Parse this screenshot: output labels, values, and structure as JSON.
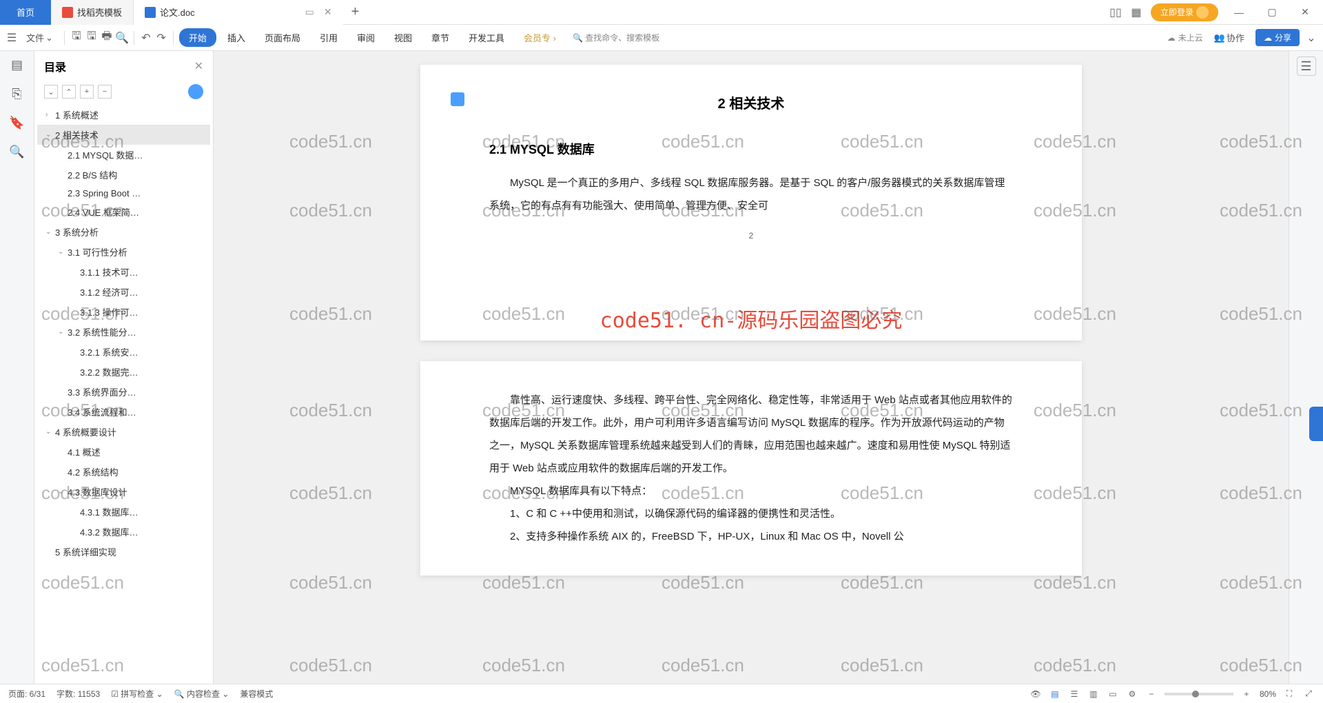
{
  "titlebar": {
    "home": "首页",
    "tab1": "找稻壳模板",
    "tab2": "论文.doc",
    "login": "立即登录"
  },
  "toolbar": {
    "file": "文件",
    "menus": [
      "开始",
      "插入",
      "页面布局",
      "引用",
      "审阅",
      "视图",
      "章节",
      "开发工具",
      "会员专"
    ],
    "search_placeholder": "查找命令、搜索模板",
    "cloud": "未上云",
    "collab": "协作",
    "share": "分享"
  },
  "outline": {
    "title": "目录",
    "items": [
      {
        "level": 1,
        "chev": "›",
        "text": "1 系统概述"
      },
      {
        "level": 1,
        "chev": "⌄",
        "text": "2 相关技术",
        "selected": true
      },
      {
        "level": 2,
        "text": "2.1 MYSQL 数据…"
      },
      {
        "level": 2,
        "text": "2.2 B/S 结构"
      },
      {
        "level": 2,
        "text": "2.3 Spring Boot …"
      },
      {
        "level": 2,
        "text": "2.4 VUE 框架简…"
      },
      {
        "level": 1,
        "chev": "⌄",
        "text": "3 系统分析"
      },
      {
        "level": 2,
        "chev": "⌄",
        "text": "3.1 可行性分析"
      },
      {
        "level": 3,
        "text": "3.1.1 技术可…"
      },
      {
        "level": 3,
        "text": "3.1.2 经济可…"
      },
      {
        "level": 3,
        "text": "3.1.3 操作可…"
      },
      {
        "level": 2,
        "chev": "⌄",
        "text": "3.2 系统性能分…"
      },
      {
        "level": 3,
        "text": "3.2.1 系统安…"
      },
      {
        "level": 3,
        "text": "3.2.2 数据完…"
      },
      {
        "level": 2,
        "text": "3.3 系统界面分…"
      },
      {
        "level": 2,
        "text": "3.4 系统流程和…"
      },
      {
        "level": 1,
        "chev": "⌄",
        "text": "4 系统概要设计"
      },
      {
        "level": 2,
        "text": "4.1 概述"
      },
      {
        "level": 2,
        "text": "4.2 系统结构"
      },
      {
        "level": 2,
        "chev": "⌄",
        "text": "4.3.数据库设计"
      },
      {
        "level": 3,
        "text": "4.3.1 数据库…"
      },
      {
        "level": 3,
        "text": "4.3.2 数据库…"
      },
      {
        "level": 1,
        "text": "5 系统详细实现"
      }
    ]
  },
  "document": {
    "heading1": "2 相关技术",
    "heading2": "2.1 MYSQL 数据库",
    "para1": "MySQL 是一个真正的多用户、多线程 SQL 数据库服务器。是基于 SQL 的客户/服务器模式的关系数据库管理系统，它的有点有有功能强大、使用简单、管理方便、安全可",
    "page_num": "2",
    "para2": "靠性高、运行速度快、多线程、跨平台性、完全网络化、稳定性等，非常适用于 Web 站点或者其他应用软件的数据库后端的开发工作。此外，用户可利用许多语言编写访问 MySQL 数据库的程序。作为开放源代码运动的产物之一，MySQL 关系数据库管理系统越来越受到人们的青睐，应用范围也越来越广。速度和易用性使 MySQL 特别适用于 Web 站点或应用软件的数据库后端的开发工作。",
    "para3": "MYSQL 数据库具有以下特点：",
    "para4": "1、C 和 C ++中使用和测试，以确保源代码的编译器的便携性和灵活性。",
    "para5": "2、支持多种操作系统 AIX 的，FreeBSD 下，HP-UX，Linux 和 Mac OS 中，Novell 公",
    "watermark_banner": "code51. cn-源码乐园盗图必究"
  },
  "watermark_text": "code51.cn",
  "statusbar": {
    "page": "页面: 6/31",
    "words": "字数: 11553",
    "spell": "拼写检查",
    "content": "内容检查",
    "compat": "兼容模式",
    "zoom": "80%"
  }
}
